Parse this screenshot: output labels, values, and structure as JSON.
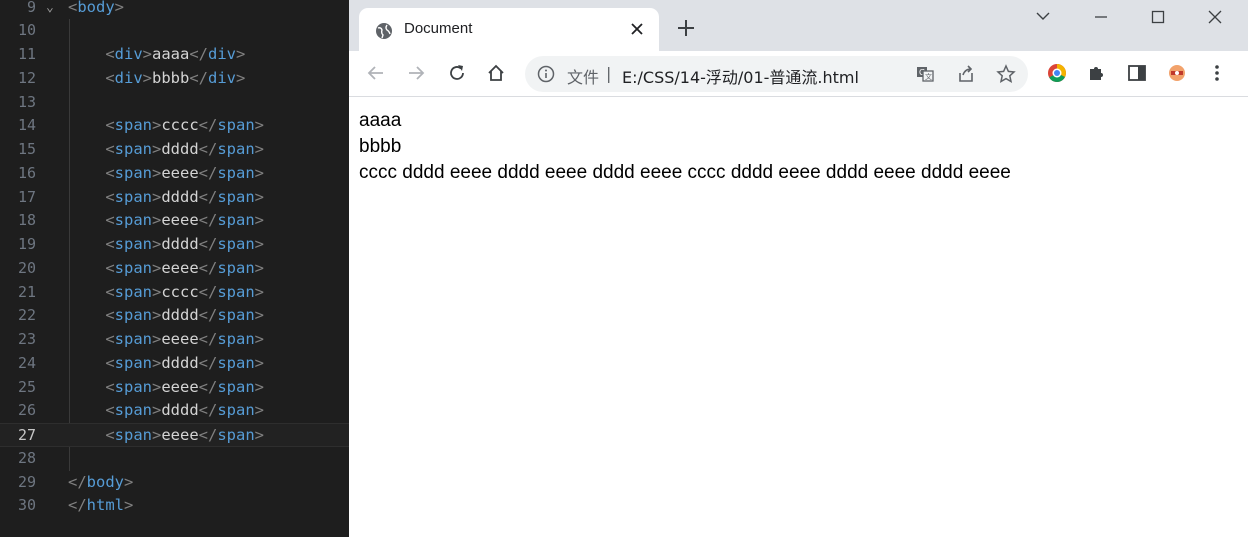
{
  "editor": {
    "lines": [
      {
        "num": "9",
        "fold": "⌄",
        "tokens": [
          [
            "br",
            "<"
          ],
          [
            "tag",
            "body"
          ],
          [
            "br",
            ">"
          ]
        ]
      },
      {
        "num": "10",
        "fold": "",
        "tokens": []
      },
      {
        "num": "11",
        "fold": "",
        "tokens": [
          [
            "txt",
            "    "
          ],
          [
            "br",
            "<"
          ],
          [
            "tag",
            "div"
          ],
          [
            "br",
            ">"
          ],
          [
            "txt",
            "aaaa"
          ],
          [
            "br",
            "</"
          ],
          [
            "tag",
            "div"
          ],
          [
            "br",
            ">"
          ]
        ]
      },
      {
        "num": "12",
        "fold": "",
        "tokens": [
          [
            "txt",
            "    "
          ],
          [
            "br",
            "<"
          ],
          [
            "tag",
            "div"
          ],
          [
            "br",
            ">"
          ],
          [
            "txt",
            "bbbb"
          ],
          [
            "br",
            "</"
          ],
          [
            "tag",
            "div"
          ],
          [
            "br",
            ">"
          ]
        ]
      },
      {
        "num": "13",
        "fold": "",
        "tokens": []
      },
      {
        "num": "14",
        "fold": "",
        "tokens": [
          [
            "txt",
            "    "
          ],
          [
            "br",
            "<"
          ],
          [
            "tag",
            "span"
          ],
          [
            "br",
            ">"
          ],
          [
            "txt",
            "cccc"
          ],
          [
            "br",
            "</"
          ],
          [
            "tag",
            "span"
          ],
          [
            "br",
            ">"
          ]
        ]
      },
      {
        "num": "15",
        "fold": "",
        "tokens": [
          [
            "txt",
            "    "
          ],
          [
            "br",
            "<"
          ],
          [
            "tag",
            "span"
          ],
          [
            "br",
            ">"
          ],
          [
            "txt",
            "dddd"
          ],
          [
            "br",
            "</"
          ],
          [
            "tag",
            "span"
          ],
          [
            "br",
            ">"
          ]
        ]
      },
      {
        "num": "16",
        "fold": "",
        "tokens": [
          [
            "txt",
            "    "
          ],
          [
            "br",
            "<"
          ],
          [
            "tag",
            "span"
          ],
          [
            "br",
            ">"
          ],
          [
            "txt",
            "eeee"
          ],
          [
            "br",
            "</"
          ],
          [
            "tag",
            "span"
          ],
          [
            "br",
            ">"
          ]
        ]
      },
      {
        "num": "17",
        "fold": "",
        "tokens": [
          [
            "txt",
            "    "
          ],
          [
            "br",
            "<"
          ],
          [
            "tag",
            "span"
          ],
          [
            "br",
            ">"
          ],
          [
            "txt",
            "dddd"
          ],
          [
            "br",
            "</"
          ],
          [
            "tag",
            "span"
          ],
          [
            "br",
            ">"
          ]
        ]
      },
      {
        "num": "18",
        "fold": "",
        "tokens": [
          [
            "txt",
            "    "
          ],
          [
            "br",
            "<"
          ],
          [
            "tag",
            "span"
          ],
          [
            "br",
            ">"
          ],
          [
            "txt",
            "eeee"
          ],
          [
            "br",
            "</"
          ],
          [
            "tag",
            "span"
          ],
          [
            "br",
            ">"
          ]
        ]
      },
      {
        "num": "19",
        "fold": "",
        "tokens": [
          [
            "txt",
            "    "
          ],
          [
            "br",
            "<"
          ],
          [
            "tag",
            "span"
          ],
          [
            "br",
            ">"
          ],
          [
            "txt",
            "dddd"
          ],
          [
            "br",
            "</"
          ],
          [
            "tag",
            "span"
          ],
          [
            "br",
            ">"
          ]
        ]
      },
      {
        "num": "20",
        "fold": "",
        "tokens": [
          [
            "txt",
            "    "
          ],
          [
            "br",
            "<"
          ],
          [
            "tag",
            "span"
          ],
          [
            "br",
            ">"
          ],
          [
            "txt",
            "eeee"
          ],
          [
            "br",
            "</"
          ],
          [
            "tag",
            "span"
          ],
          [
            "br",
            ">"
          ]
        ]
      },
      {
        "num": "21",
        "fold": "",
        "tokens": [
          [
            "txt",
            "    "
          ],
          [
            "br",
            "<"
          ],
          [
            "tag",
            "span"
          ],
          [
            "br",
            ">"
          ],
          [
            "txt",
            "cccc"
          ],
          [
            "br",
            "</"
          ],
          [
            "tag",
            "span"
          ],
          [
            "br",
            ">"
          ]
        ]
      },
      {
        "num": "22",
        "fold": "",
        "tokens": [
          [
            "txt",
            "    "
          ],
          [
            "br",
            "<"
          ],
          [
            "tag",
            "span"
          ],
          [
            "br",
            ">"
          ],
          [
            "txt",
            "dddd"
          ],
          [
            "br",
            "</"
          ],
          [
            "tag",
            "span"
          ],
          [
            "br",
            ">"
          ]
        ]
      },
      {
        "num": "23",
        "fold": "",
        "tokens": [
          [
            "txt",
            "    "
          ],
          [
            "br",
            "<"
          ],
          [
            "tag",
            "span"
          ],
          [
            "br",
            ">"
          ],
          [
            "txt",
            "eeee"
          ],
          [
            "br",
            "</"
          ],
          [
            "tag",
            "span"
          ],
          [
            "br",
            ">"
          ]
        ]
      },
      {
        "num": "24",
        "fold": "",
        "tokens": [
          [
            "txt",
            "    "
          ],
          [
            "br",
            "<"
          ],
          [
            "tag",
            "span"
          ],
          [
            "br",
            ">"
          ],
          [
            "txt",
            "dddd"
          ],
          [
            "br",
            "</"
          ],
          [
            "tag",
            "span"
          ],
          [
            "br",
            ">"
          ]
        ]
      },
      {
        "num": "25",
        "fold": "",
        "tokens": [
          [
            "txt",
            "    "
          ],
          [
            "br",
            "<"
          ],
          [
            "tag",
            "span"
          ],
          [
            "br",
            ">"
          ],
          [
            "txt",
            "eeee"
          ],
          [
            "br",
            "</"
          ],
          [
            "tag",
            "span"
          ],
          [
            "br",
            ">"
          ]
        ]
      },
      {
        "num": "26",
        "fold": "",
        "tokens": [
          [
            "txt",
            "    "
          ],
          [
            "br",
            "<"
          ],
          [
            "tag",
            "span"
          ],
          [
            "br",
            ">"
          ],
          [
            "txt",
            "dddd"
          ],
          [
            "br",
            "</"
          ],
          [
            "tag",
            "span"
          ],
          [
            "br",
            ">"
          ]
        ]
      },
      {
        "num": "27",
        "fold": "",
        "current": true,
        "tokens": [
          [
            "txt",
            "    "
          ],
          [
            "br",
            "<"
          ],
          [
            "tag",
            "span"
          ],
          [
            "br",
            ">"
          ],
          [
            "txt",
            "eeee"
          ],
          [
            "br",
            "</"
          ],
          [
            "tag",
            "span"
          ],
          [
            "br",
            ">"
          ]
        ]
      },
      {
        "num": "28",
        "fold": "",
        "tokens": []
      },
      {
        "num": "29",
        "fold": "",
        "tokens": [
          [
            "br",
            "</"
          ],
          [
            "tag",
            "body"
          ],
          [
            "br",
            ">"
          ]
        ]
      },
      {
        "num": "30",
        "fold": "",
        "tokens": [
          [
            "br",
            "</"
          ],
          [
            "tag",
            "html"
          ],
          [
            "br",
            ">"
          ]
        ]
      }
    ]
  },
  "browser": {
    "tab_title": "Document",
    "address_label": "文件",
    "address_separator": "|",
    "url": "E:/CSS/14-浮动/01-普通流.html",
    "page": {
      "block1": "aaaa",
      "block2": "bbbb",
      "inline": "cccc dddd eeee dddd eeee dddd eeee cccc dddd eeee dddd eeee dddd eeee"
    }
  },
  "colors": {
    "editor_bg": "#1e1e1e",
    "tag": "#569cd6",
    "bracket": "#808080",
    "text": "#d4d4d4",
    "tabstrip_bg": "#dee1e6",
    "omnibox_bg": "#f1f3f4"
  },
  "icons": {
    "tab": "globe-icon",
    "toolbar": [
      "back-arrow-icon",
      "forward-arrow-icon",
      "reload-icon",
      "home-icon"
    ],
    "omnibox": [
      "info-icon",
      "translate-icon",
      "share-icon",
      "star-icon"
    ],
    "extensions": [
      "chrome-extension-icon",
      "puzzle-icon",
      "sidepanel-icon",
      "profile-extension-icon",
      "kebab-menu-icon"
    ],
    "window": [
      "tab-search-chevron-icon",
      "minimize-icon",
      "maximize-icon",
      "close-window-icon"
    ]
  }
}
